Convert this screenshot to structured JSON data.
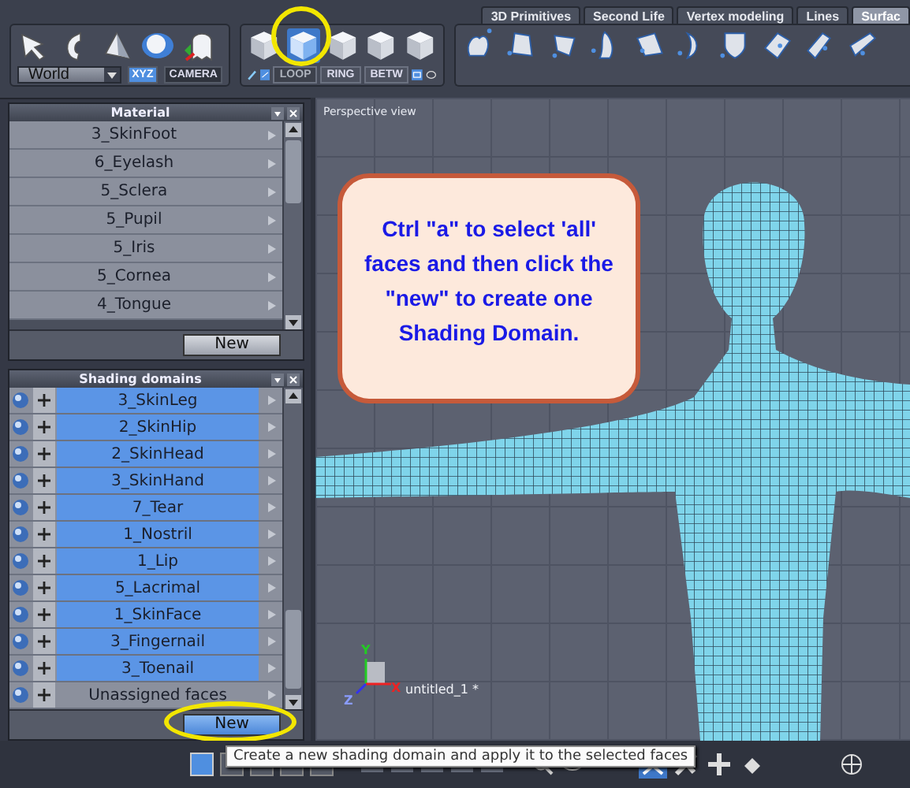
{
  "toolbar": {
    "tabs": [
      {
        "label": "3D Primitives",
        "selected": false
      },
      {
        "label": "Second Life",
        "selected": false
      },
      {
        "label": "Vertex modeling",
        "selected": false
      },
      {
        "label": "Lines",
        "selected": false
      },
      {
        "label": "Surfac",
        "selected": true
      }
    ],
    "coordinate_space": "World",
    "frame_buttons": [
      {
        "label": "XYZ",
        "selected": true
      },
      {
        "label": "CAMERA",
        "selected": false
      }
    ],
    "selection_modes": [
      {
        "selected": false
      },
      {
        "selected": true
      },
      {
        "selected": false
      },
      {
        "selected": false
      },
      {
        "selected": false
      }
    ],
    "edge_buttons": [
      {
        "label": "LOOP",
        "disabled": true
      },
      {
        "label": "RING",
        "disabled": false
      },
      {
        "label": "BETW",
        "disabled": false
      }
    ]
  },
  "material_panel": {
    "title": "Material",
    "items": [
      {
        "label": "3_SkinFoot"
      },
      {
        "label": "6_Eyelash"
      },
      {
        "label": "5_Sclera"
      },
      {
        "label": "5_Pupil"
      },
      {
        "label": "5_Iris"
      },
      {
        "label": "5_Cornea"
      },
      {
        "label": "4_Tongue"
      }
    ],
    "button": "New"
  },
  "shading_panel": {
    "title": "Shading domains",
    "items": [
      {
        "label": "3_SkinLeg",
        "selected": true
      },
      {
        "label": "2_SkinHip",
        "selected": true
      },
      {
        "label": "2_SkinHead",
        "selected": true
      },
      {
        "label": "3_SkinHand",
        "selected": true
      },
      {
        "label": "7_Tear",
        "selected": true
      },
      {
        "label": "1_Nostril",
        "selected": true
      },
      {
        "label": "1_Lip",
        "selected": true
      },
      {
        "label": "5_Lacrimal",
        "selected": true
      },
      {
        "label": "1_SkinFace",
        "selected": true
      },
      {
        "label": "3_Fingernail",
        "selected": true
      },
      {
        "label": "3_Toenail",
        "selected": true
      },
      {
        "label": "Unassigned faces",
        "selected": false
      }
    ],
    "button": "New"
  },
  "viewport": {
    "title": "Perspective view",
    "callout": "Ctrl \"a\" to select 'all' faces and then click the \"new\" to create one Shading Domain.",
    "axes": {
      "x": "X",
      "y": "Y",
      "z": "Z"
    },
    "object_label": "untitled_1 *"
  },
  "tooltip": "Create a new shading domain and apply it to the selected faces"
}
